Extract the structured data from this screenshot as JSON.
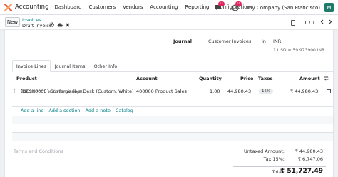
{
  "app": {
    "title": "Accounting",
    "menu": [
      "Dashboard",
      "Customers",
      "Vendors",
      "Accounting",
      "Reporting",
      "Configuration"
    ],
    "chat_badge": "11",
    "activity_badge": "14",
    "company": "My Company (San Francisco)",
    "avatar_letter": "M",
    "brand_color": "#f06050"
  },
  "control": {
    "new_label": "New",
    "breadcrumb_parent": "Invoices",
    "breadcrumb_current": "Draft Invoice",
    "pager": "1 / 1"
  },
  "form": {
    "journal_label": "Journal",
    "journal_value": "Customer Invoices",
    "in_label": "in",
    "currency": "INR",
    "rate": "1 USD = 59.973900 INR"
  },
  "tabs": [
    "Invoice Lines",
    "Journal Items",
    "Other Info"
  ],
  "table": {
    "headers": {
      "product": "Product",
      "account": "Account",
      "quantity": "Quantity",
      "price": "Price",
      "taxes": "Taxes",
      "amount": "Amount"
    },
    "rows": [
      {
        "product": "[DESK0005] Customizable Desk (Custom, White)",
        "description": "160x80cm, with large legs.",
        "account": "400000 Product Sales",
        "quantity": "1.00",
        "price": "44,980.43",
        "tax": "15%",
        "amount": "₹ 44,980.43"
      }
    ],
    "add_links": [
      "Add a line",
      "Add a section",
      "Add a note",
      "Catalog"
    ]
  },
  "footer": {
    "terms_placeholder": "Terms and Conditions",
    "untaxed_label": "Untaxed Amount:",
    "untaxed_value": "₹ 44,980.43",
    "tax_label": "Tax 15%:",
    "tax_value": "₹ 6,747.06",
    "total_label": "Total:",
    "total_value": "₹ 51,727.49"
  }
}
